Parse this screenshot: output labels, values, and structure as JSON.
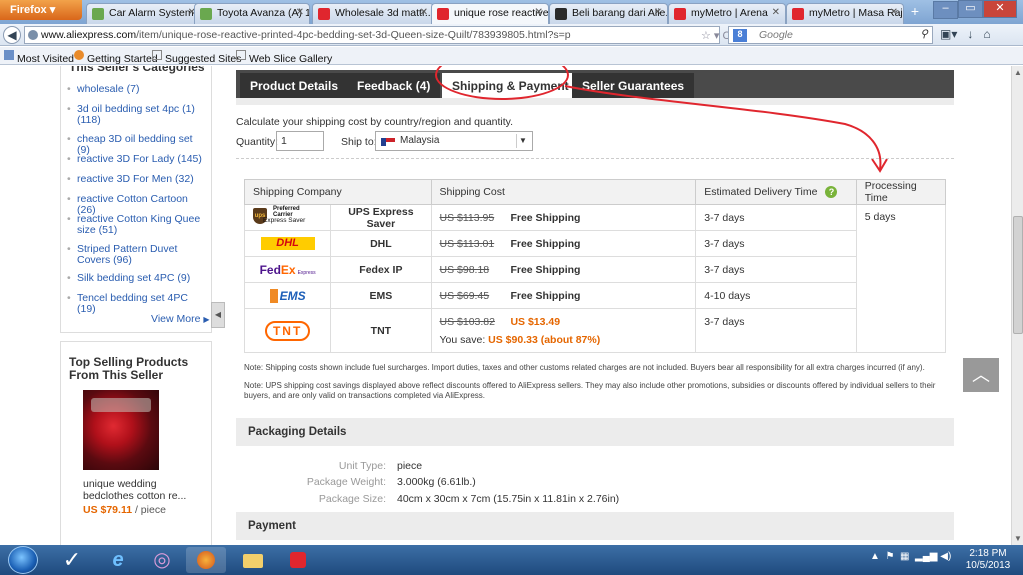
{
  "browser": {
    "menu_label": "Firefox",
    "tabs": [
      {
        "title": "Car Alarm System ...",
        "fav_color": "#6aa84f"
      },
      {
        "title": "Toyota Avanza (A) 1...",
        "fav_color": "#6aa84f"
      },
      {
        "title": "Wholesale 3d mattr...",
        "fav_color": "#e0262e"
      },
      {
        "title": "unique rose reactive...",
        "fav_color": "#e0262e"
      },
      {
        "title": "Beli barang dari Alie...",
        "fav_color": "#2b2b2b"
      },
      {
        "title": "myMetro | Arena",
        "fav_color": "#e0262e"
      },
      {
        "title": "myMetro | Masa Raj...",
        "fav_color": "#e0262e"
      }
    ],
    "url_host": "www.aliexpress.com",
    "url_path": "/item/unique-rose-reactive-printed-4pc-bedding-set-3d-Queen-size-Quilt/783939805.html?s=p",
    "search_placeholder": "Google",
    "bookmarks": [
      "Most Visited",
      "Getting Started",
      "Suggested Sites",
      "Web Slice Gallery"
    ]
  },
  "sidebar": {
    "title": "This Seller's Categories",
    "items": [
      "wholesale (7)",
      "3d oil bedding set 4pc (1) (118)",
      "cheap 3D oil bedding set (9)",
      "reactive 3D For Lady (145)",
      "reactive 3D For Men (32)",
      "reactive Cotton Cartoon (26)",
      "reactive Cotton King Quee size (51)",
      "Striped Pattern Duvet Covers (96)",
      "Silk bedding set 4PC (9)",
      "Tencel bedding set 4PC (19)"
    ],
    "view_more": "View More",
    "top_selling_title": "Top Selling Products From This Seller",
    "product_name": "unique wedding bedclothes cotton re...",
    "product_price": "US $79.11",
    "product_unit": "/ piece"
  },
  "product_tabs": [
    "Product Details",
    "Feedback (4)",
    "Shipping & Payment",
    "Seller Guarantees"
  ],
  "shipping": {
    "section_label": "Shipping",
    "calc_text": "Calculate your shipping cost by country/region and quantity.",
    "quantity_label": "Quantity:",
    "quantity_value": "1",
    "ship_to_label": "Ship to:",
    "ship_to_value": "Malaysia",
    "headers": [
      "Shipping Company",
      "Shipping Cost",
      "Estimated Delivery Time",
      "Processing Time"
    ],
    "processing_time": "5 days",
    "rows": [
      {
        "name": "UPS Express Saver",
        "old": "US $113.95",
        "cost": "Free Shipping",
        "eta": "3-7 days",
        "logo": "ups"
      },
      {
        "name": "DHL",
        "old": "US $113.01",
        "cost": "Free Shipping",
        "eta": "3-7 days",
        "logo": "dhl"
      },
      {
        "name": "Fedex IP",
        "old": "US $98.18",
        "cost": "Free Shipping",
        "eta": "3-7 days",
        "logo": "fedex"
      },
      {
        "name": "EMS",
        "old": "US $69.45",
        "cost": "Free Shipping",
        "eta": "4-10 days",
        "logo": "ems"
      },
      {
        "name": "TNT",
        "old": "US $103.82",
        "cost": "US $13.49",
        "eta": "3-7 days",
        "logo": "tnt",
        "save_label": "You save:",
        "save_value": "US $90.33 (about 87%)"
      }
    ],
    "logo_text": {
      "ups_line1": "Preferred",
      "ups_line2": "Carrier",
      "ups_line3": "Express Saver",
      "dhl": "DHL",
      "fedex_a": "Fed",
      "fedex_b": "Ex",
      "fedex_sub": "Express",
      "ems": "EMS",
      "tnt": "TNT"
    },
    "note1": "Note: Shipping costs shown include fuel surcharges. Import duties, taxes and other customs related charges are not included. Buyers bear all responsibility for all extra charges incurred (if any).",
    "note2": "Note: UPS shipping cost savings displayed above reflect discounts offered to AliExpress sellers. They may also include other promotions, subsidies or discounts offered by individual sellers to their buyers, and are only valid on transactions completed via AliExpress."
  },
  "packaging": {
    "title": "Packaging Details",
    "unit_type_label": "Unit Type:",
    "unit_type": "piece",
    "weight_label": "Package Weight:",
    "weight": "3.000kg (6.61lb.)",
    "size_label": "Package Size:",
    "size": "40cm x 30cm x 7cm (15.75in x 11.81in x 2.76in)"
  },
  "payment": {
    "title": "Payment"
  },
  "taskbar": {
    "time": "2:18 PM",
    "date": "10/5/2013"
  }
}
